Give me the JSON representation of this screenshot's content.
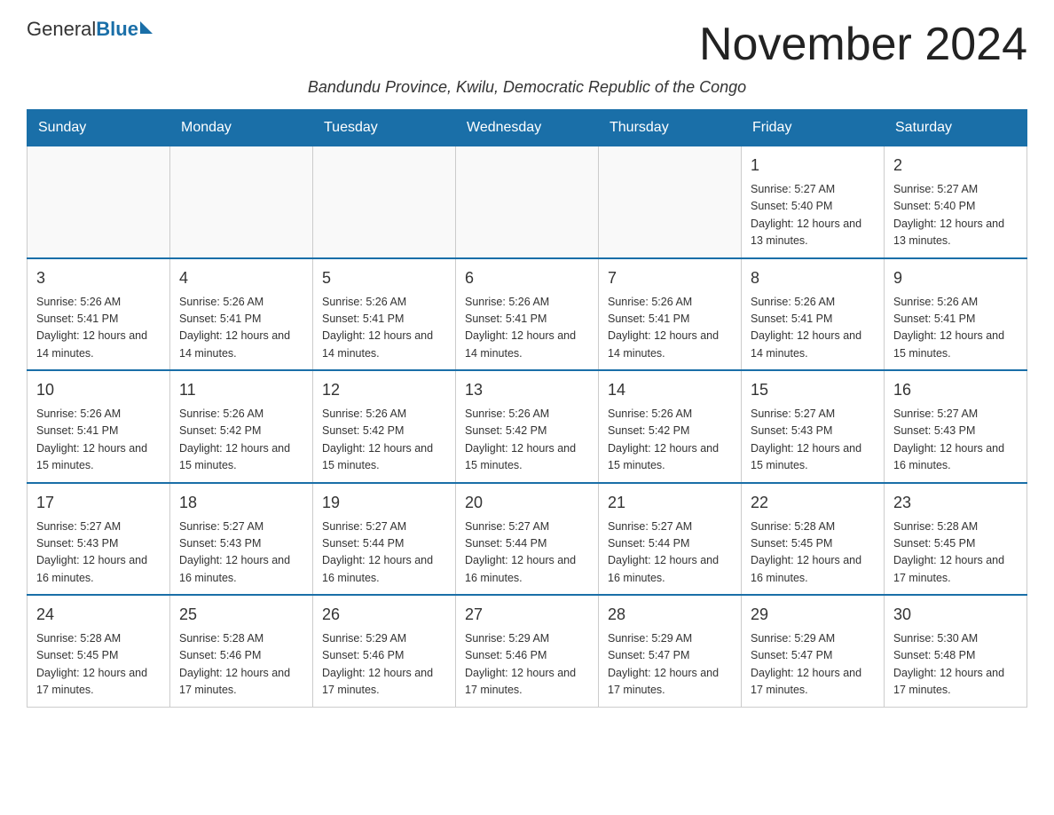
{
  "header": {
    "logo_general": "General",
    "logo_blue": "Blue",
    "month_title": "November 2024",
    "subtitle": "Bandundu Province, Kwilu, Democratic Republic of the Congo"
  },
  "days_of_week": [
    "Sunday",
    "Monday",
    "Tuesday",
    "Wednesday",
    "Thursday",
    "Friday",
    "Saturday"
  ],
  "weeks": [
    [
      {
        "day": "",
        "sunrise": "",
        "sunset": "",
        "daylight": "",
        "empty": true
      },
      {
        "day": "",
        "sunrise": "",
        "sunset": "",
        "daylight": "",
        "empty": true
      },
      {
        "day": "",
        "sunrise": "",
        "sunset": "",
        "daylight": "",
        "empty": true
      },
      {
        "day": "",
        "sunrise": "",
        "sunset": "",
        "daylight": "",
        "empty": true
      },
      {
        "day": "",
        "sunrise": "",
        "sunset": "",
        "daylight": "",
        "empty": true
      },
      {
        "day": "1",
        "sunrise": "Sunrise: 5:27 AM",
        "sunset": "Sunset: 5:40 PM",
        "daylight": "Daylight: 12 hours and 13 minutes.",
        "empty": false
      },
      {
        "day": "2",
        "sunrise": "Sunrise: 5:27 AM",
        "sunset": "Sunset: 5:40 PM",
        "daylight": "Daylight: 12 hours and 13 minutes.",
        "empty": false
      }
    ],
    [
      {
        "day": "3",
        "sunrise": "Sunrise: 5:26 AM",
        "sunset": "Sunset: 5:41 PM",
        "daylight": "Daylight: 12 hours and 14 minutes.",
        "empty": false
      },
      {
        "day": "4",
        "sunrise": "Sunrise: 5:26 AM",
        "sunset": "Sunset: 5:41 PM",
        "daylight": "Daylight: 12 hours and 14 minutes.",
        "empty": false
      },
      {
        "day": "5",
        "sunrise": "Sunrise: 5:26 AM",
        "sunset": "Sunset: 5:41 PM",
        "daylight": "Daylight: 12 hours and 14 minutes.",
        "empty": false
      },
      {
        "day": "6",
        "sunrise": "Sunrise: 5:26 AM",
        "sunset": "Sunset: 5:41 PM",
        "daylight": "Daylight: 12 hours and 14 minutes.",
        "empty": false
      },
      {
        "day": "7",
        "sunrise": "Sunrise: 5:26 AM",
        "sunset": "Sunset: 5:41 PM",
        "daylight": "Daylight: 12 hours and 14 minutes.",
        "empty": false
      },
      {
        "day": "8",
        "sunrise": "Sunrise: 5:26 AM",
        "sunset": "Sunset: 5:41 PM",
        "daylight": "Daylight: 12 hours and 14 minutes.",
        "empty": false
      },
      {
        "day": "9",
        "sunrise": "Sunrise: 5:26 AM",
        "sunset": "Sunset: 5:41 PM",
        "daylight": "Daylight: 12 hours and 15 minutes.",
        "empty": false
      }
    ],
    [
      {
        "day": "10",
        "sunrise": "Sunrise: 5:26 AM",
        "sunset": "Sunset: 5:41 PM",
        "daylight": "Daylight: 12 hours and 15 minutes.",
        "empty": false
      },
      {
        "day": "11",
        "sunrise": "Sunrise: 5:26 AM",
        "sunset": "Sunset: 5:42 PM",
        "daylight": "Daylight: 12 hours and 15 minutes.",
        "empty": false
      },
      {
        "day": "12",
        "sunrise": "Sunrise: 5:26 AM",
        "sunset": "Sunset: 5:42 PM",
        "daylight": "Daylight: 12 hours and 15 minutes.",
        "empty": false
      },
      {
        "day": "13",
        "sunrise": "Sunrise: 5:26 AM",
        "sunset": "Sunset: 5:42 PM",
        "daylight": "Daylight: 12 hours and 15 minutes.",
        "empty": false
      },
      {
        "day": "14",
        "sunrise": "Sunrise: 5:26 AM",
        "sunset": "Sunset: 5:42 PM",
        "daylight": "Daylight: 12 hours and 15 minutes.",
        "empty": false
      },
      {
        "day": "15",
        "sunrise": "Sunrise: 5:27 AM",
        "sunset": "Sunset: 5:43 PM",
        "daylight": "Daylight: 12 hours and 15 minutes.",
        "empty": false
      },
      {
        "day": "16",
        "sunrise": "Sunrise: 5:27 AM",
        "sunset": "Sunset: 5:43 PM",
        "daylight": "Daylight: 12 hours and 16 minutes.",
        "empty": false
      }
    ],
    [
      {
        "day": "17",
        "sunrise": "Sunrise: 5:27 AM",
        "sunset": "Sunset: 5:43 PM",
        "daylight": "Daylight: 12 hours and 16 minutes.",
        "empty": false
      },
      {
        "day": "18",
        "sunrise": "Sunrise: 5:27 AM",
        "sunset": "Sunset: 5:43 PM",
        "daylight": "Daylight: 12 hours and 16 minutes.",
        "empty": false
      },
      {
        "day": "19",
        "sunrise": "Sunrise: 5:27 AM",
        "sunset": "Sunset: 5:44 PM",
        "daylight": "Daylight: 12 hours and 16 minutes.",
        "empty": false
      },
      {
        "day": "20",
        "sunrise": "Sunrise: 5:27 AM",
        "sunset": "Sunset: 5:44 PM",
        "daylight": "Daylight: 12 hours and 16 minutes.",
        "empty": false
      },
      {
        "day": "21",
        "sunrise": "Sunrise: 5:27 AM",
        "sunset": "Sunset: 5:44 PM",
        "daylight": "Daylight: 12 hours and 16 minutes.",
        "empty": false
      },
      {
        "day": "22",
        "sunrise": "Sunrise: 5:28 AM",
        "sunset": "Sunset: 5:45 PM",
        "daylight": "Daylight: 12 hours and 16 minutes.",
        "empty": false
      },
      {
        "day": "23",
        "sunrise": "Sunrise: 5:28 AM",
        "sunset": "Sunset: 5:45 PM",
        "daylight": "Daylight: 12 hours and 17 minutes.",
        "empty": false
      }
    ],
    [
      {
        "day": "24",
        "sunrise": "Sunrise: 5:28 AM",
        "sunset": "Sunset: 5:45 PM",
        "daylight": "Daylight: 12 hours and 17 minutes.",
        "empty": false
      },
      {
        "day": "25",
        "sunrise": "Sunrise: 5:28 AM",
        "sunset": "Sunset: 5:46 PM",
        "daylight": "Daylight: 12 hours and 17 minutes.",
        "empty": false
      },
      {
        "day": "26",
        "sunrise": "Sunrise: 5:29 AM",
        "sunset": "Sunset: 5:46 PM",
        "daylight": "Daylight: 12 hours and 17 minutes.",
        "empty": false
      },
      {
        "day": "27",
        "sunrise": "Sunrise: 5:29 AM",
        "sunset": "Sunset: 5:46 PM",
        "daylight": "Daylight: 12 hours and 17 minutes.",
        "empty": false
      },
      {
        "day": "28",
        "sunrise": "Sunrise: 5:29 AM",
        "sunset": "Sunset: 5:47 PM",
        "daylight": "Daylight: 12 hours and 17 minutes.",
        "empty": false
      },
      {
        "day": "29",
        "sunrise": "Sunrise: 5:29 AM",
        "sunset": "Sunset: 5:47 PM",
        "daylight": "Daylight: 12 hours and 17 minutes.",
        "empty": false
      },
      {
        "day": "30",
        "sunrise": "Sunrise: 5:30 AM",
        "sunset": "Sunset: 5:48 PM",
        "daylight": "Daylight: 12 hours and 17 minutes.",
        "empty": false
      }
    ]
  ]
}
